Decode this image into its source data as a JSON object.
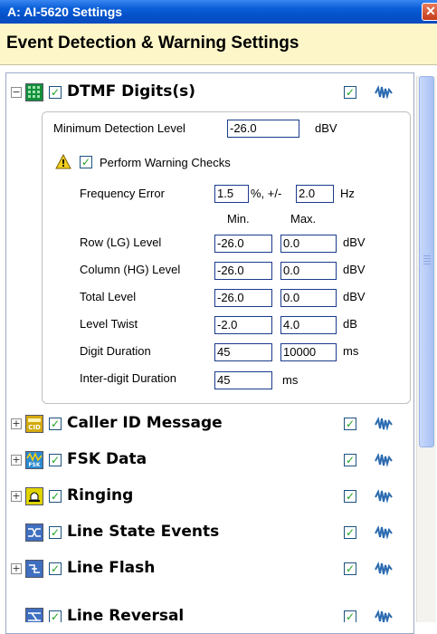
{
  "window": {
    "title": "A: AI-5620  Settings"
  },
  "header": {
    "title": "Event Detection & Warning Settings"
  },
  "dtmf": {
    "label": "DTMF Digits(s)",
    "min_detection_label": "Minimum Detection Level",
    "min_detection_value": "-26.0",
    "min_detection_unit": "dBV",
    "perform_warning_label": "Perform Warning Checks",
    "freq_error_label": "Frequency Error",
    "freq_error_value": "1.5",
    "freq_error_sep": "%, +/-",
    "freq_error_hz_value": "2.0",
    "freq_error_unit": "Hz",
    "min_header": "Min.",
    "max_header": "Max.",
    "rows": [
      {
        "label": "Row (LG) Level",
        "min": "-26.0",
        "max": "0.0",
        "unit": "dBV"
      },
      {
        "label": "Column (HG) Level",
        "min": "-26.0",
        "max": "0.0",
        "unit": "dBV"
      },
      {
        "label": "Total Level",
        "min": "-26.0",
        "max": "0.0",
        "unit": "dBV"
      },
      {
        "label": "Level Twist",
        "min": "-2.0",
        "max": "4.0",
        "unit": "dB"
      },
      {
        "label": "Digit Duration",
        "min": "45",
        "max": "10000",
        "unit": "ms"
      }
    ],
    "interdigit_label": "Inter-digit Duration",
    "interdigit_value": "45",
    "interdigit_unit": "ms"
  },
  "sections": [
    {
      "label": "Caller ID Message",
      "icon": "caller-id-icon"
    },
    {
      "label": "FSK Data",
      "icon": "fsk-icon"
    },
    {
      "label": "Ringing",
      "icon": "ringing-icon"
    },
    {
      "label": "Line State Events",
      "icon": "line-state-icon"
    },
    {
      "label": "Line Flash",
      "icon": "line-flash-icon"
    },
    {
      "label": "Line Reversal",
      "icon": "line-reversal-icon"
    }
  ],
  "icons": {
    "section_icon_text": {
      "caller": "CID",
      "fsk": "FSK"
    }
  },
  "colors": {
    "check": "#21a121",
    "titlebar": "#0a5fd8",
    "header_bg": "#fdf6c8"
  }
}
